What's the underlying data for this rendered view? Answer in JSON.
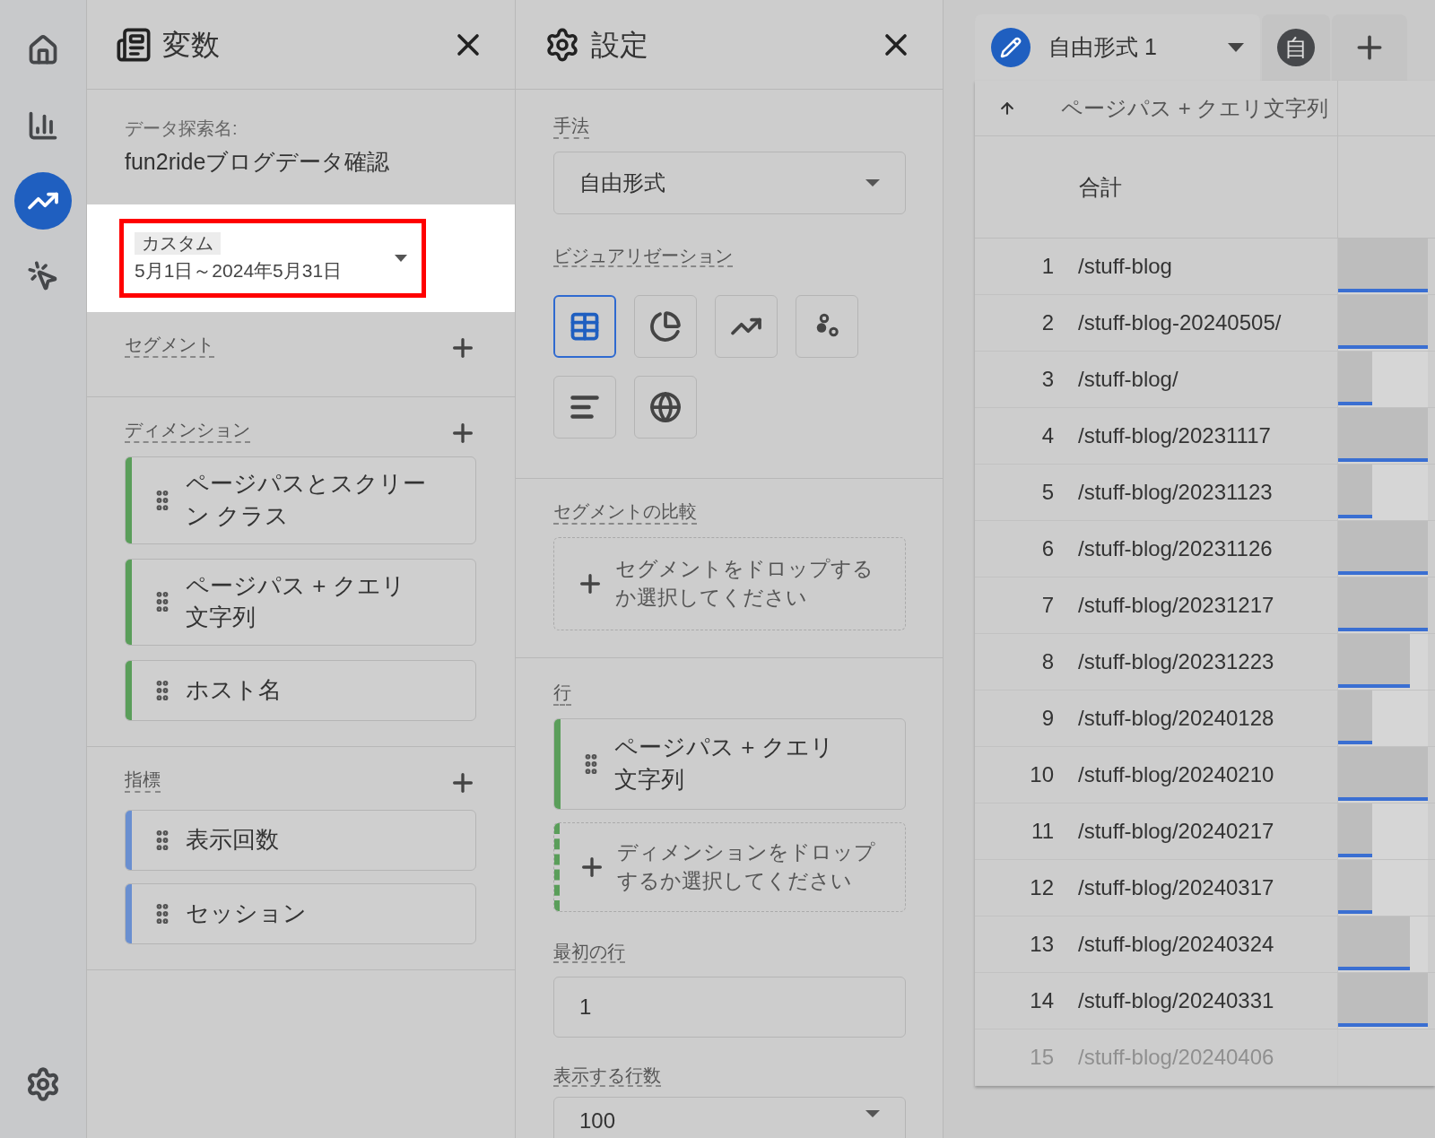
{
  "nav": {
    "items": [
      {
        "kind": "home",
        "selected": false
      },
      {
        "kind": "reports",
        "selected": false
      },
      {
        "kind": "explore",
        "selected": true
      },
      {
        "kind": "advertising",
        "selected": false
      }
    ]
  },
  "variables": {
    "title": "変数",
    "explore_label": "データ探索名:",
    "explore_name": "fun2rideブログデータ確認",
    "date_range": {
      "tag": "カスタム",
      "value": "5月1日～2024年5月31日",
      "highlighted": true
    },
    "segments": {
      "title": "セグメント"
    },
    "dimensions": {
      "title": "ディメンション",
      "items": [
        {
          "label": "ページパスとスクリーン クラス",
          "color": "#5a9e5a"
        },
        {
          "label": "ページパス + クエリ文字列",
          "color": "#5a9e5a"
        },
        {
          "label": "ホスト名",
          "color": "#5a9e5a"
        }
      ]
    },
    "metrics": {
      "title": "指標",
      "items": [
        {
          "label": "表示回数",
          "color": "#6a8fd0"
        },
        {
          "label": "セッション",
          "color": "#6a8fd0"
        }
      ]
    }
  },
  "settings": {
    "title": "設定",
    "method_label": "手法",
    "method_value": "自由形式",
    "visualization_label": "ビジュアリゼーション",
    "visualizations": [
      {
        "kind": "table",
        "selected": true
      },
      {
        "kind": "donut",
        "selected": false
      },
      {
        "kind": "line",
        "selected": false
      },
      {
        "kind": "scatter",
        "selected": false
      },
      {
        "kind": "bar",
        "selected": false
      },
      {
        "kind": "geo",
        "selected": false
      }
    ],
    "segment_compare_label": "セグメントの比較",
    "segment_drop": "セグメントをドロップするか選択してください",
    "rows_label": "行",
    "rows": [
      {
        "kind": "item",
        "label": "ページパス + クエリ文字列"
      },
      {
        "kind": "drop",
        "label": "ディメンションをドロップするか選択してください"
      }
    ],
    "first_row_label": "最初の行",
    "first_row_value": "1",
    "show_rows_label": "表示する行数",
    "show_rows_value": "100"
  },
  "tabs": [
    {
      "label": "自由形式 1",
      "selected": true
    },
    {
      "label": "自",
      "selected": false
    }
  ],
  "table": {
    "column_header": "ページパス + クエリ文字列",
    "total_label": "合計",
    "rows": [
      {
        "n": "1",
        "path": "/stuff-blog",
        "level": 1,
        "faded": false
      },
      {
        "n": "2",
        "path": "/stuff-blog-20240505/",
        "level": 1,
        "faded": false
      },
      {
        "n": "3",
        "path": "/stuff-blog/",
        "level": 0.38,
        "faded": false
      },
      {
        "n": "4",
        "path": "/stuff-blog/20231117",
        "level": 1,
        "faded": false
      },
      {
        "n": "5",
        "path": "/stuff-blog/20231123",
        "level": 0.38,
        "faded": false
      },
      {
        "n": "6",
        "path": "/stuff-blog/20231126",
        "level": 1,
        "faded": false
      },
      {
        "n": "7",
        "path": "/stuff-blog/20231217",
        "level": 1,
        "faded": false
      },
      {
        "n": "8",
        "path": "/stuff-blog/20231223",
        "level": 0.8,
        "faded": false
      },
      {
        "n": "9",
        "path": "/stuff-blog/20240128",
        "level": 0.38,
        "faded": false
      },
      {
        "n": "10",
        "path": "/stuff-blog/20240210",
        "level": 1,
        "faded": false
      },
      {
        "n": "11",
        "path": "/stuff-blog/20240217",
        "level": 0.38,
        "faded": false
      },
      {
        "n": "12",
        "path": "/stuff-blog/20240317",
        "level": 0.38,
        "faded": false
      },
      {
        "n": "13",
        "path": "/stuff-blog/20240324",
        "level": 0.8,
        "faded": false
      },
      {
        "n": "14",
        "path": "/stuff-blog/20240331",
        "level": 1,
        "faded": false
      },
      {
        "n": "15",
        "path": "/stuff-blog/20240406",
        "faded": true
      }
    ]
  }
}
